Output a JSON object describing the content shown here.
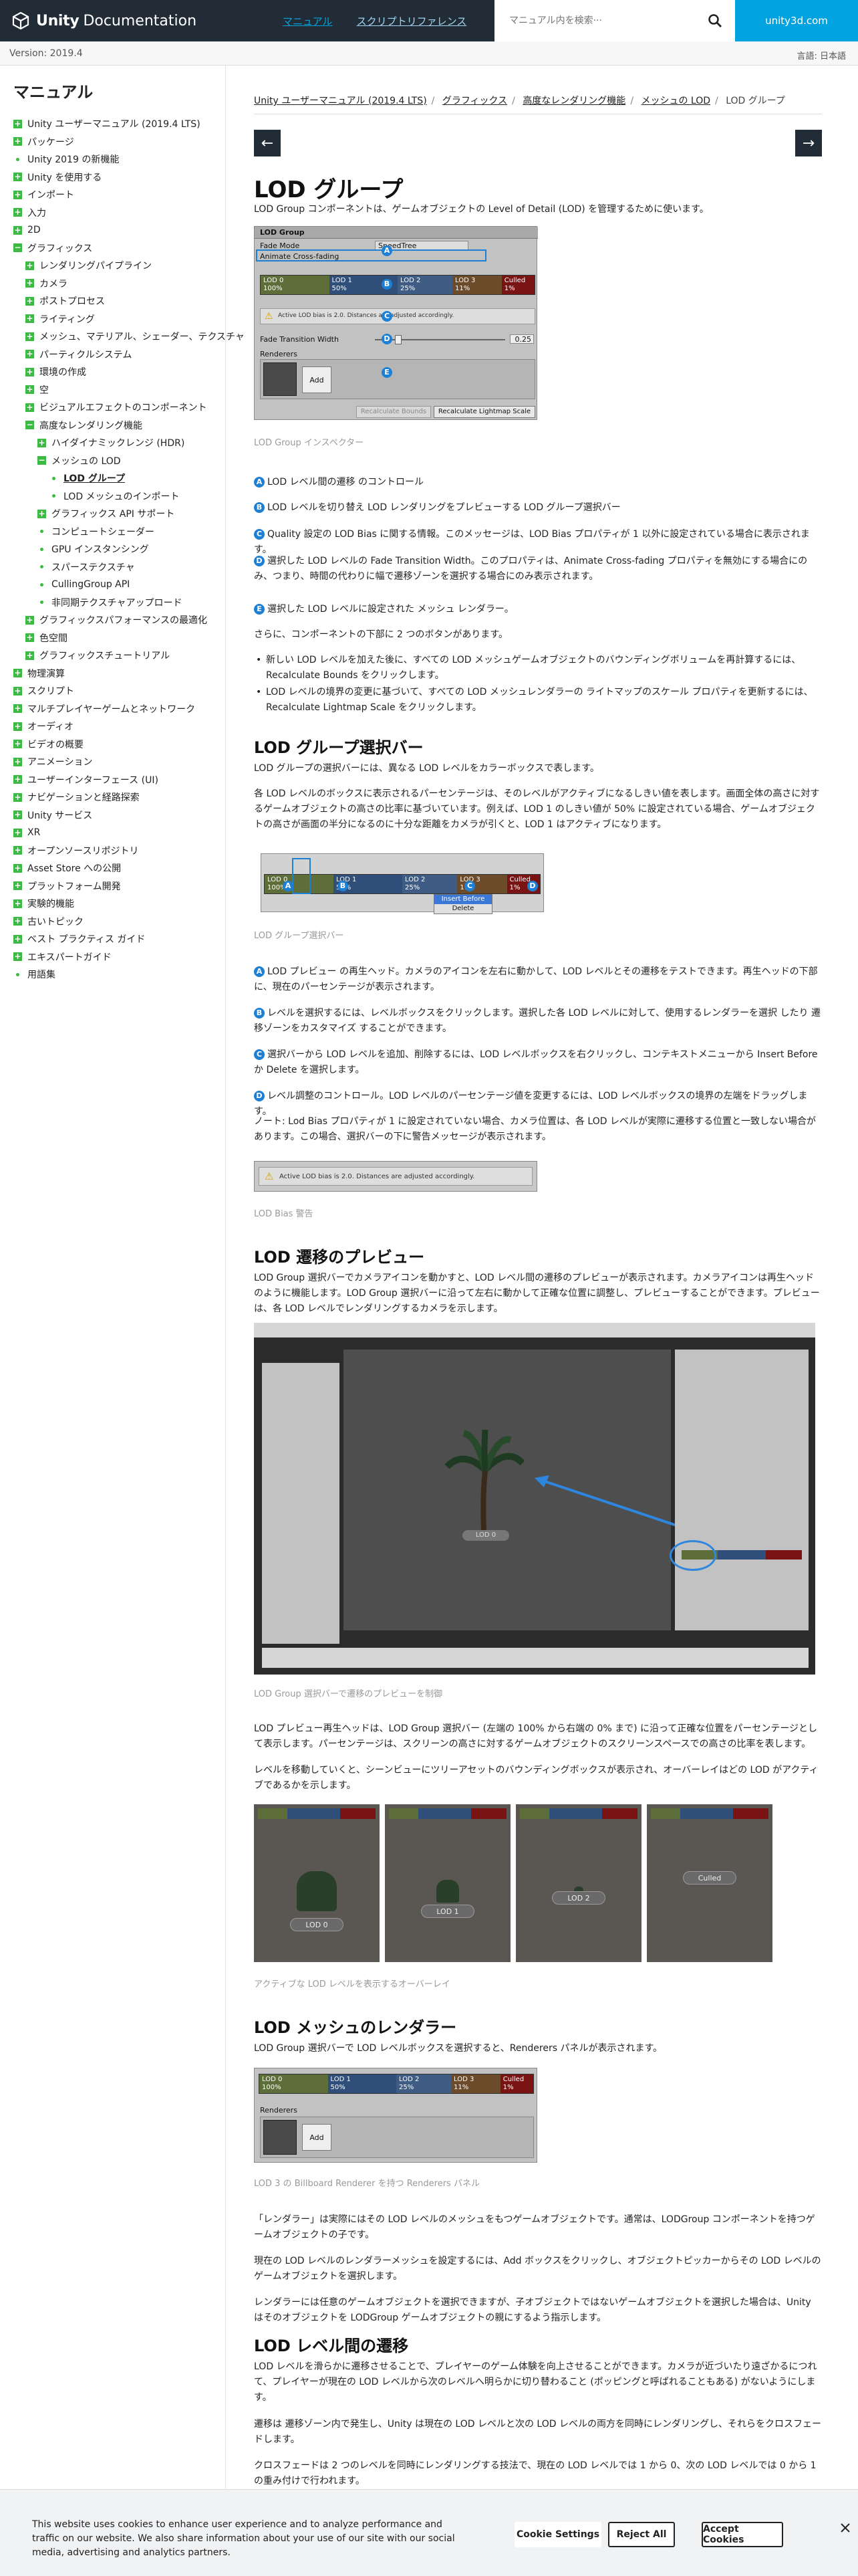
{
  "header": {
    "logo_text": "Unity",
    "logo_sub": "Documentation",
    "tabs": [
      "マニュアル",
      "スクリプトリファレンス"
    ],
    "search_placeholder": "マニュアル内を検索···",
    "unity_link": "unity3d.com"
  },
  "versionbar": {
    "version": "Version: 2019.4",
    "language": "言語: 日本語"
  },
  "sidebar": {
    "title": "マニュアル",
    "items": [
      {
        "label": "Unity ユーザーマニュアル (2019.4 LTS)",
        "level": 0,
        "icon": "plus"
      },
      {
        "label": "パッケージ",
        "level": 0,
        "icon": "plus"
      },
      {
        "label": "Unity 2019 の新機能",
        "level": 0,
        "icon": "dot"
      },
      {
        "label": "Unity を使用する",
        "level": 0,
        "icon": "plus"
      },
      {
        "label": "インポート",
        "level": 0,
        "icon": "plus"
      },
      {
        "label": "入力",
        "level": 0,
        "icon": "plus"
      },
      {
        "label": "2D",
        "level": 0,
        "icon": "plus"
      },
      {
        "label": "グラフィックス",
        "level": 0,
        "icon": "minus"
      },
      {
        "label": "レンダリングパイプライン",
        "level": 1,
        "icon": "plus"
      },
      {
        "label": "カメラ",
        "level": 1,
        "icon": "plus"
      },
      {
        "label": "ポストプロセス",
        "level": 1,
        "icon": "plus"
      },
      {
        "label": "ライティング",
        "level": 1,
        "icon": "plus"
      },
      {
        "label": "メッシュ、マテリアル、シェーダー、テクスチャ",
        "level": 1,
        "icon": "plus"
      },
      {
        "label": "パーティクルシステム",
        "level": 1,
        "icon": "plus"
      },
      {
        "label": "環境の作成",
        "level": 1,
        "icon": "plus"
      },
      {
        "label": "空",
        "level": 1,
        "icon": "plus"
      },
      {
        "label": "ビジュアルエフェクトのコンポーネント",
        "level": 1,
        "icon": "plus"
      },
      {
        "label": "高度なレンダリング機能",
        "level": 1,
        "icon": "minus"
      },
      {
        "label": "ハイダイナミックレンジ (HDR)",
        "level": 2,
        "icon": "plus"
      },
      {
        "label": "メッシュの LOD",
        "level": 2,
        "icon": "minus"
      },
      {
        "label": "LOD グループ",
        "level": 3,
        "icon": "dot",
        "current": true
      },
      {
        "label": "LOD メッシュのインポート",
        "level": 3,
        "icon": "dot"
      },
      {
        "label": "グラフィックス API サポート",
        "level": 2,
        "icon": "plus"
      },
      {
        "label": "コンピュートシェーダー",
        "level": 2,
        "icon": "dot"
      },
      {
        "label": "GPU インスタンシング",
        "level": 2,
        "icon": "dot"
      },
      {
        "label": "スパーステクスチャ",
        "level": 2,
        "icon": "dot"
      },
      {
        "label": "CullingGroup API",
        "level": 2,
        "icon": "dot"
      },
      {
        "label": "非同期テクスチャアップロード",
        "level": 2,
        "icon": "dot"
      },
      {
        "label": "グラフィックスパフォーマンスの最適化",
        "level": 1,
        "icon": "plus"
      },
      {
        "label": "色空間",
        "level": 1,
        "icon": "plus"
      },
      {
        "label": "グラフィックスチュートリアル",
        "level": 1,
        "icon": "plus"
      },
      {
        "label": "物理演算",
        "level": 0,
        "icon": "plus"
      },
      {
        "label": "スクリプト",
        "level": 0,
        "icon": "plus"
      },
      {
        "label": "マルチプレイヤーゲームとネットワーク",
        "level": 0,
        "icon": "plus"
      },
      {
        "label": "オーディオ",
        "level": 0,
        "icon": "plus"
      },
      {
        "label": "ビデオの概要",
        "level": 0,
        "icon": "plus"
      },
      {
        "label": "アニメーション",
        "level": 0,
        "icon": "plus"
      },
      {
        "label": "ユーザーインターフェース (UI)",
        "level": 0,
        "icon": "plus"
      },
      {
        "label": "ナビゲーションと経路探索",
        "level": 0,
        "icon": "plus"
      },
      {
        "label": "Unity サービス",
        "level": 0,
        "icon": "plus"
      },
      {
        "label": "XR",
        "level": 0,
        "icon": "plus"
      },
      {
        "label": "オープンソースリポジトリ",
        "level": 0,
        "icon": "plus"
      },
      {
        "label": "Asset Store への公開",
        "level": 0,
        "icon": "plus"
      },
      {
        "label": "プラットフォーム開発",
        "level": 0,
        "icon": "plus"
      },
      {
        "label": "実験的機能",
        "level": 0,
        "icon": "plus"
      },
      {
        "label": "古いトピック",
        "level": 0,
        "icon": "plus"
      },
      {
        "label": "ベスト プラクティス ガイド",
        "level": 0,
        "icon": "plus"
      },
      {
        "label": "エキスパートガイド",
        "level": 0,
        "icon": "plus"
      },
      {
        "label": "用語集",
        "level": 0,
        "icon": "dot"
      }
    ]
  },
  "breadcrumb": [
    "Unity ユーザーマニュアル (2019.4 LTS)",
    "グラフィックス",
    "高度なレンダリング機能",
    "メッシュの LOD",
    "LOD グループ"
  ],
  "page": {
    "title": "LOD グループ",
    "intro": "LOD Group コンポーネントは、ゲームオブジェクトの Level of Detail (LOD) を管理するために使います。",
    "cap_inspector": "LOD Group インスペクター",
    "list_a": "LOD レベル間の遷移 のコントロール",
    "list_b": "LOD レベルを切り替え LOD レンダリングをプレビューする LOD グループ選択バー",
    "list_c": "Quality 設定の LOD Bias に関する情報。このメッセージは、LOD Bias プロパティが 1 以外に設定されている場合に表示されます。",
    "list_d": "選択した LOD レベルの Fade Transition Width。このプロパティは、Animate Cross-fading プロパティを無効にする場合にのみ、つまり、時間の代わりに幅で遷移ゾーンを選択する場合にのみ表示されます。",
    "list_e": "選択した LOD レベルに設定された メッシュ レンダラー。",
    "buttons_intro": "さらに、コンポーネントの下部に 2 つのボタンがあります。",
    "bullet_1": "新しい LOD レベルを加えた後に、すべての LOD メッシュゲームオブジェクトのバウンディングボリュームを再計算するには、Recalculate Bounds をクリックします。",
    "bullet_2": "LOD レベルの境界の変更に基づいて、すべての LOD メッシュレンダラーの ライトマップのスケール プロパティを更新するには、Recalculate Lightmap Scale をクリックします。",
    "h_selection": "LOD グループ選択バー",
    "sel_p1": "LOD グループの選択バーには、異なる LOD レベルをカラーボックスで表します。",
    "sel_p2": "各 LOD レベルのボックスに表示されるパーセンテージは、そのレベルがアクティブになるしきい値を表します。画面全体の高さに対するゲームオブジェクトの高さの比率に基づいています。例えば、LOD 1 のしきい値が 50% に設定されている場合、ゲームオブジェクトの高さが画面の半分になるのに十分な距離をカメラが引くと、LOD 1 はアクティブになります。",
    "cap_selection": "LOD グループ選択バー",
    "sel_a": "LOD プレビュー の再生ヘッド。カメラのアイコンを左右に動かして、LOD レベルとその遷移をテストできます。再生ヘッドの下部に、現在のパーセンテージが表示されます。",
    "sel_b": "レベルを選択するには、レベルボックスをクリックします。選択した各 LOD レベルに対して、使用するレンダラーを選択 したり 遷移ゾーンをカスタマイズ することができます。",
    "sel_c": "選択バーから LOD レベルを追加、削除するには、LOD レベルボックスを右クリックし、コンテキストメニューから Insert Before か Delete を選択します。",
    "sel_d": "レベル調整のコントロール。LOD レベルのパーセンテージ値を変更するには、LOD レベルボックスの境界の左端をドラッグします。",
    "note": "ノート: Lod Bias プロパティが 1 に設定されていない場合、カメラ位置は、各 LOD レベルが実際に遷移する位置と一致しない場合があります。この場合、選択バーの下に警告メッセージが表示されます。",
    "cap_bias": "LOD Bias 警告",
    "h_preview": "LOD 遷移のプレビュー",
    "prev_p1": "LOD Group 選択バーでカメラアイコンを動かすと、LOD レベル間の遷移のプレビューが表示されます。カメラアイコンは再生ヘッドのように機能します。LOD Group 選択バーに沿って左右に動かして正確な位置に調整し、プレビューすることができます。プレビューは、各 LOD レベルでレンダリングするカメラを示します。",
    "cap_preview": "LOD Group 選択バーで遷移のプレビューを制御",
    "prev_p2": "LOD プレビュー再生ヘッドは、LOD Group 選択バー (左端の 100% から右端の 0% まで) に沿って正確な位置をパーセンテージとして表示します。パーセンテージは、スクリーンの高さに対するゲームオブジェクトのスクリーンスペースでの高さの比率を表します。",
    "prev_p3": "レベルを移動していくと、シーンビューにツリーアセットのバウンディングボックスが表示され、オーバーレイはどの LOD がアクティブであるかを示します。",
    "cap_overlay": "アクティブな LOD レベルを表示するオーバーレイ",
    "h_renderers": "LOD メッシュのレンダラー",
    "rend_p1": "LOD Group 選択バーで LOD レベルボックスを選択すると、Renderers パネルが表示されます。",
    "cap_renderers": "LOD 3 の Billboard Renderer を持つ Renderers パネル",
    "rend_p2": "「レンダラー」は実際にはその LOD レベルのメッシュをもつゲームオブジェクトです。通常は、LODGroup コンポーネントを持つゲームオブジェクトの子です。",
    "rend_p3": "現在の LOD レベルのレンダラーメッシュを設定するには、Add ボックスをクリックし、オブジェクトピッカーからその LOD レベルのゲームオブジェクトを選択します。",
    "rend_p4": "レンダラーには任意のゲームオブジェクトを選択できますが、子オブジェクトではないゲームオブジェクトを選択した場合は、Unity はそのオブジェクトを LODGroup ゲームオブジェクトの親にするよう指示します。",
    "h_transition": "LOD レベル間の遷移",
    "tr_p1": "LOD レベルを滑らかに遷移させることで、プレイヤーのゲーム体験を向上させることができます。カメラが近づいたり遠ざかるにつれて、プレイヤーが現在の LOD レベルから次のレベルへ明らかに切り替わること (ポッピングと呼ばれることもある) がないようにします。",
    "tr_p2": "遷移は 遷移ゾーン内で発生し、Unity は現在の LOD レベルと次の LOD レベルの両方を同時にレンダリングし、それらをクロスフェードします。",
    "tr_p3": "クロスフェードは 2 つのレベルを同時にレンダリングする技法で、現在の LOD レベルでは 1 から 0、次の LOD レベルでは 0 から 1 の重み付けで行われます。"
  },
  "inspector": {
    "component": "LOD Group",
    "fade_mode_label": "Fade Mode",
    "fade_mode_value": "SpeedTree",
    "animate_label": "Animate Cross-fading",
    "lods": [
      {
        "name": "LOD 0",
        "pct": "100%",
        "color": "#5e6e3b"
      },
      {
        "name": "LOD 1",
        "pct": "50%",
        "color": "#2f4f7a"
      },
      {
        "name": "LOD 2",
        "pct": "25%",
        "color": "#3f5c84"
      },
      {
        "name": "LOD 3",
        "pct": "11%",
        "color": "#6b4b2a"
      },
      {
        "name": "Culled",
        "pct": "1%",
        "color": "#7a1414"
      }
    ],
    "bias_msg": "Active LOD bias is 2.0. Distances are adjusted accordingly.",
    "fade_width_label": "Fade Transition Width",
    "fade_width_value": "0.25",
    "renderers_label": "Renderers",
    "add_label": "Add",
    "recalc_bounds": "Recalculate Bounds",
    "recalc_lightmap": "Recalculate Lightmap Scale",
    "insert_before": "Insert Before",
    "delete": "Delete",
    "markers": [
      "A",
      "B",
      "C",
      "D",
      "E"
    ]
  },
  "overlays": [
    "LOD 0",
    "LOD 1",
    "LOD 2",
    "Culled"
  ],
  "preview_label": "LOD 0",
  "cookie": {
    "text": "This website uses cookies to enhance user experience and to analyze performance and traffic on our website. We also share information about your use of our site with our social media, advertising and analytics partners.",
    "settings": "Cookie Settings",
    "reject": "Reject All",
    "accept": "Accept Cookies"
  },
  "colors": {
    "header": "#222c37",
    "accent": "#00a3e0",
    "tree_icon": "#3dba44",
    "marker": "#1d80d4"
  }
}
